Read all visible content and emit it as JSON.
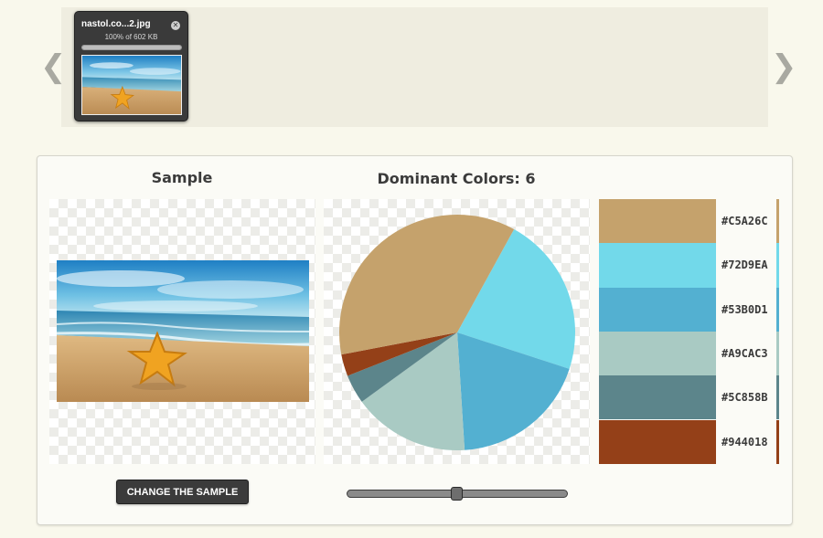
{
  "upload": {
    "prev_glyph": "❮",
    "next_glyph": "❯",
    "file": {
      "name": "nastol.co...2.jpg",
      "size_text": "100% of 602 KB",
      "progress": 1.0,
      "close_glyph": "✕"
    }
  },
  "sample": {
    "heading": "Sample",
    "button_label": "CHANGE THE SAMPLE"
  },
  "dominant": {
    "heading": "Dominant Colors: 6",
    "slider_value": 0.5
  },
  "palette": [
    {
      "hex": "#C5A26C",
      "color": "#C5A26C"
    },
    {
      "hex": "#72D9EA",
      "color": "#72D9EA"
    },
    {
      "hex": "#53B0D1",
      "color": "#53B0D1"
    },
    {
      "hex": "#A9CAC3",
      "color": "#A9CAC3"
    },
    {
      "hex": "#5C858B",
      "color": "#5C858B"
    },
    {
      "hex": "#944018",
      "color": "#944018"
    }
  ],
  "chart_data": {
    "type": "pie",
    "slices": [
      {
        "color": "#72D9EA",
        "value": 22
      },
      {
        "color": "#53B0D1",
        "value": 19
      },
      {
        "color": "#A9CAC3",
        "value": 16
      },
      {
        "color": "#5C858B",
        "value": 4
      },
      {
        "color": "#944018",
        "value": 3
      },
      {
        "color": "#C5A26C",
        "value": 36
      }
    ]
  }
}
